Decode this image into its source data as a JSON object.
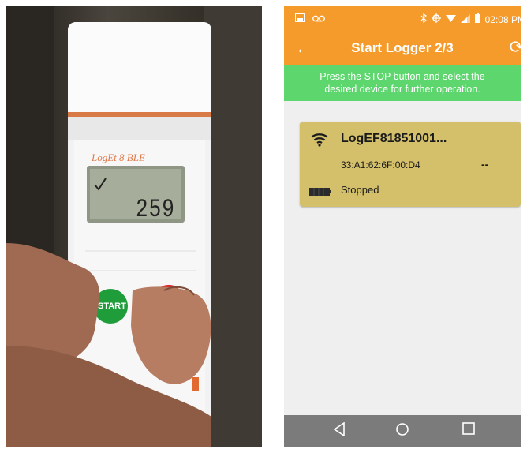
{
  "photo": {
    "device_brand": "LogEt 8 BLE",
    "lcd_reading": "259",
    "start_button_label": "START"
  },
  "phone": {
    "status_bar": {
      "time": "02:08 PM"
    },
    "app_bar": {
      "title": "Start Logger 2/3"
    },
    "banner": {
      "line1": "Press the STOP button and select the",
      "line2": "desired device for further operation."
    },
    "device_card": {
      "name": "LogEF81851001...",
      "mac": "33:A1:62:6F:00:D4",
      "reading": "--",
      "status": "Stopped"
    },
    "icons": {
      "back": "back-arrow-icon",
      "refresh": "refresh-icon",
      "wifi": "wifi-icon",
      "battery": "battery-icon",
      "nav_back": "nav-back-icon",
      "nav_home": "nav-home-icon",
      "nav_recent": "nav-recent-icon"
    },
    "colors": {
      "app_bar": "#f49b2c",
      "banner": "#5dd66e",
      "card": "#d4c06a",
      "nav_bar": "#7b7b7b"
    }
  }
}
